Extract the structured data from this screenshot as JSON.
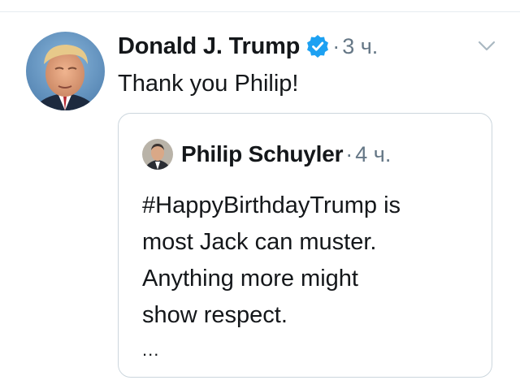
{
  "tweet": {
    "author_name": "Donald J. Trump",
    "verified_icon": "verified-badge-icon",
    "separator": "·",
    "time": "3 ч.",
    "text": "Thank you Philip!",
    "menu_icon": "chevron-down-icon"
  },
  "quoted_tweet": {
    "author_name": "Philip Schuyler",
    "separator": "·",
    "time": "4 ч.",
    "text_lines": [
      "#HappyBirthdayTrump is",
      "most Jack can muster.",
      "Anything more might",
      "show respect."
    ],
    "more": "..."
  },
  "colors": {
    "verified": "#1da1f2",
    "meta_gray": "#657786",
    "border": "#ccd6dd"
  }
}
